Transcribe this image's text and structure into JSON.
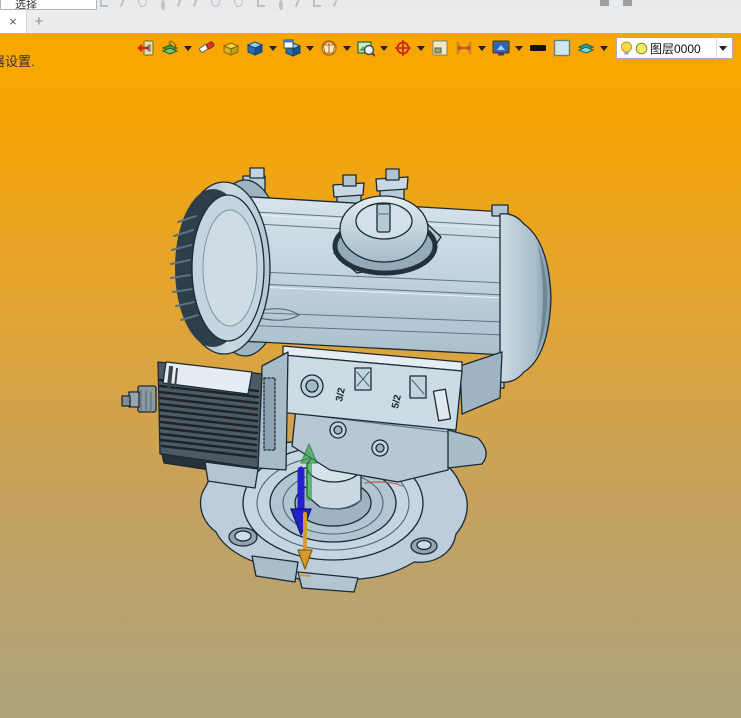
{
  "colors": {
    "toolbar_orange": "#F8A701",
    "viewport_bottom": "#AEA47D",
    "model_body": "#C6D6E1",
    "tabbar_bg": "#EBECEE",
    "axis_green": "#2F9E3F",
    "axis_blue": "#2222CC",
    "axis_orange": "#D89A28"
  },
  "quickbar": {
    "combo_value": "选择"
  },
  "tabbar": {
    "close_label": "×",
    "new_tab_label": "+"
  },
  "toolbar": {
    "icon_names": [
      "exit-icon",
      "layer-settings-icon",
      "eraser-icon",
      "isometric-box-icon",
      "shaded-cube-icon",
      "display-window-icon",
      "wireframe-sphere-icon",
      "zoom-image-icon",
      "orientation-target-icon",
      "window-select-icon",
      "measure-icon",
      "render-scene-icon",
      "line-width-icon",
      "color-swatch-icon",
      "layer-visibility-icon"
    ],
    "layer_combo": {
      "value": "图层0000"
    }
  },
  "viewport": {
    "overlay_text": "器设置."
  },
  "model": {
    "valve_label_1": "3/2",
    "valve_label_2": "5/2"
  }
}
